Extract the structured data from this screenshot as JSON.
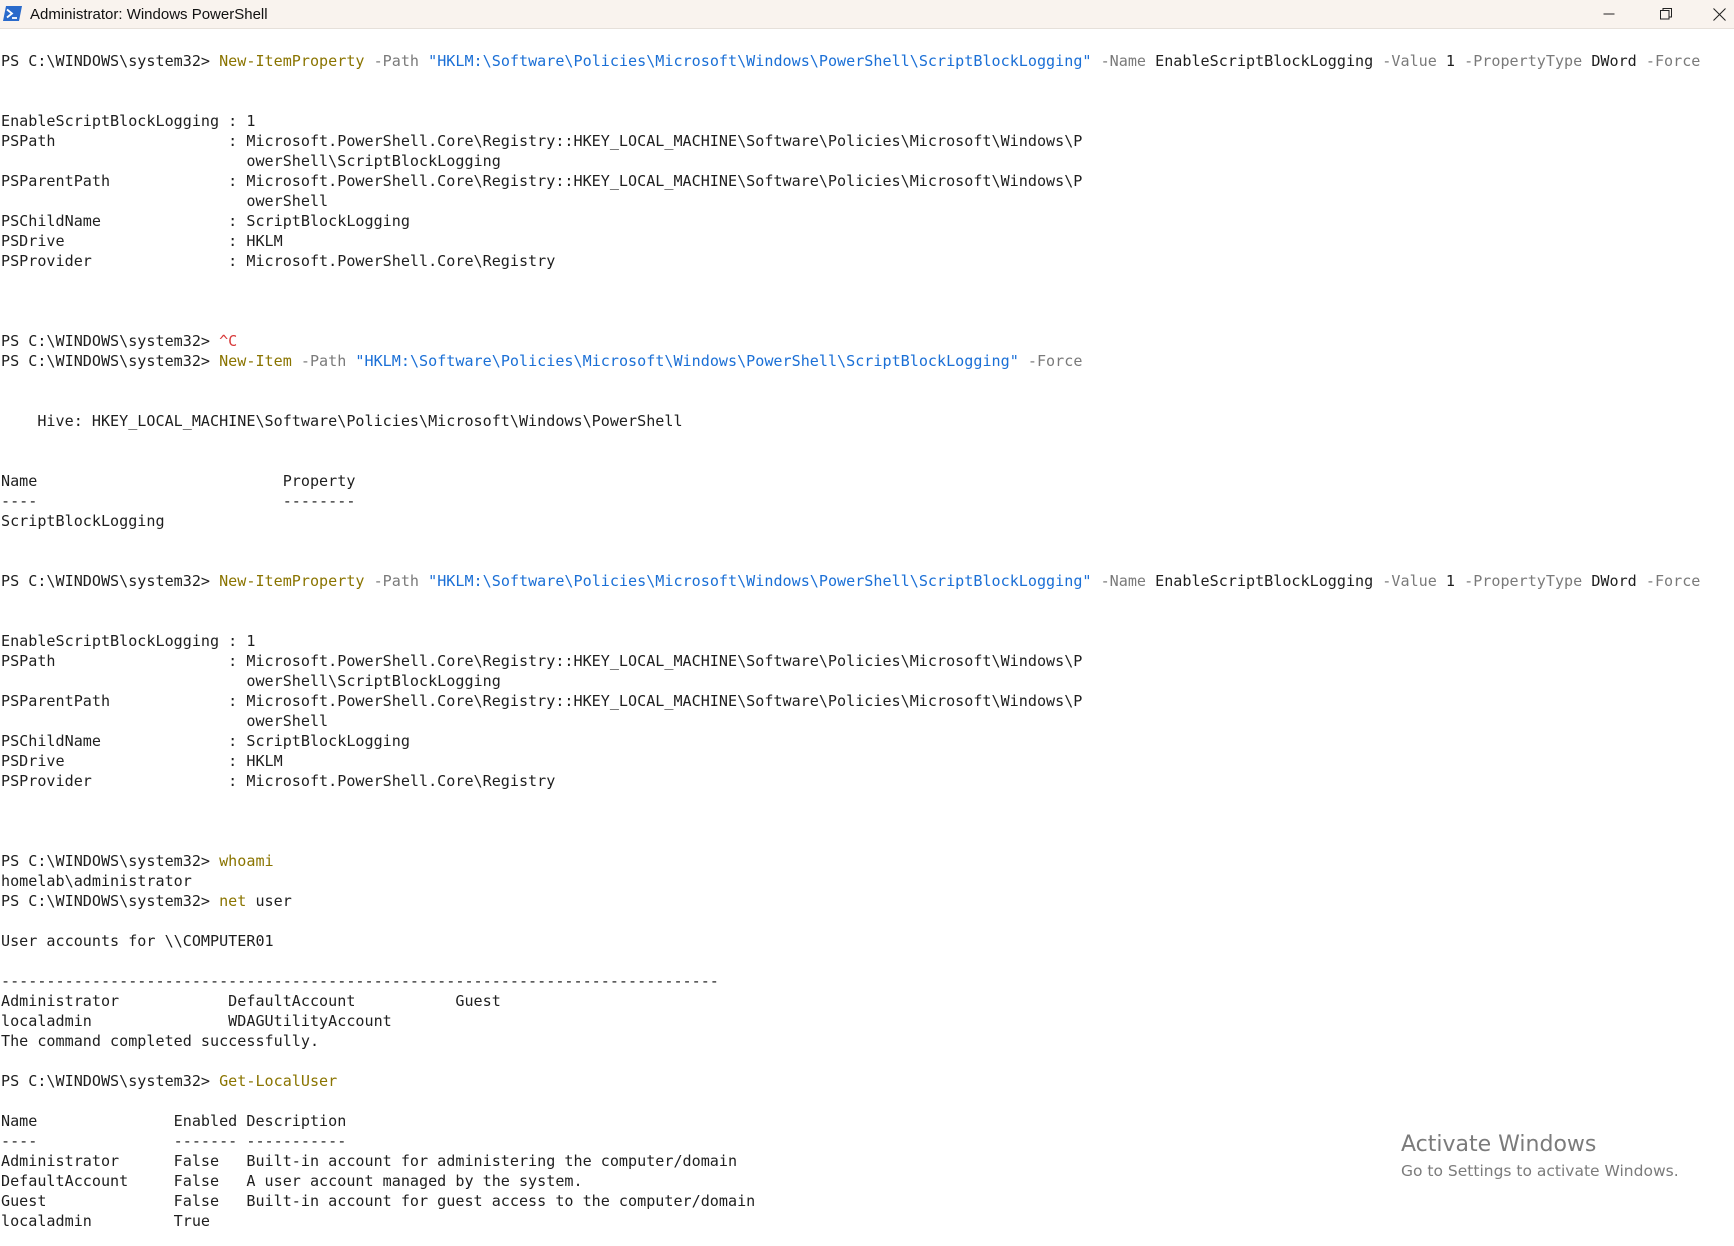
{
  "window": {
    "title": "Administrator: Windows PowerShell",
    "icon": "powershell-icon",
    "controls": {
      "minimize": "minimize-icon",
      "restore": "restore-icon",
      "close": "close-icon"
    }
  },
  "colors": {
    "background": "#ffffff",
    "text": "#1e1e1e",
    "cmdlet": "#8a7400",
    "parameter": "#7a7a7a",
    "string": "#1a6fd6",
    "ctrl_c": "#d83a3a"
  },
  "console": {
    "lines": [
      {
        "segs": [
          {
            "t": "PS C:\\WINDOWS\\system32> "
          },
          {
            "t": "New-ItemProperty",
            "c": "cmd"
          },
          {
            "t": " -Path ",
            "c": "param"
          },
          {
            "t": "\"HKLM:\\Software\\Policies\\Microsoft\\Windows\\PowerShell\\ScriptBlockLogging\"",
            "c": "str"
          },
          {
            "t": " -Name ",
            "c": "param"
          },
          {
            "t": "EnableScriptBlockLogging"
          },
          {
            "t": " -Value ",
            "c": "param"
          },
          {
            "t": "1"
          },
          {
            "t": " -PropertyType ",
            "c": "param"
          },
          {
            "t": "DWord"
          },
          {
            "t": " -Force",
            "c": "param"
          }
        ]
      },
      {
        "text": ""
      },
      {
        "text": ""
      },
      {
        "text": "EnableScriptBlockLogging : 1"
      },
      {
        "text": "PSPath                   : Microsoft.PowerShell.Core\\Registry::HKEY_LOCAL_MACHINE\\Software\\Policies\\Microsoft\\Windows\\P"
      },
      {
        "text": "                           owerShell\\ScriptBlockLogging"
      },
      {
        "text": "PSParentPath             : Microsoft.PowerShell.Core\\Registry::HKEY_LOCAL_MACHINE\\Software\\Policies\\Microsoft\\Windows\\P"
      },
      {
        "text": "                           owerShell"
      },
      {
        "text": "PSChildName              : ScriptBlockLogging"
      },
      {
        "text": "PSDrive                  : HKLM"
      },
      {
        "text": "PSProvider               : Microsoft.PowerShell.Core\\Registry"
      },
      {
        "text": ""
      },
      {
        "text": ""
      },
      {
        "text": ""
      },
      {
        "segs": [
          {
            "t": "PS C:\\WINDOWS\\system32> "
          },
          {
            "t": "^C",
            "c": "ctrl"
          }
        ]
      },
      {
        "segs": [
          {
            "t": "PS C:\\WINDOWS\\system32> "
          },
          {
            "t": "New-Item",
            "c": "cmd"
          },
          {
            "t": " -Path ",
            "c": "param"
          },
          {
            "t": "\"HKLM:\\Software\\Policies\\Microsoft\\Windows\\PowerShell\\ScriptBlockLogging\"",
            "c": "str"
          },
          {
            "t": " -Force",
            "c": "param"
          }
        ]
      },
      {
        "text": ""
      },
      {
        "text": ""
      },
      {
        "text": "    Hive: HKEY_LOCAL_MACHINE\\Software\\Policies\\Microsoft\\Windows\\PowerShell"
      },
      {
        "text": ""
      },
      {
        "text": ""
      },
      {
        "text": "Name                           Property"
      },
      {
        "text": "----                           --------"
      },
      {
        "text": "ScriptBlockLogging"
      },
      {
        "text": ""
      },
      {
        "text": ""
      },
      {
        "segs": [
          {
            "t": "PS C:\\WINDOWS\\system32> "
          },
          {
            "t": "New-ItemProperty",
            "c": "cmd"
          },
          {
            "t": " -Path ",
            "c": "param"
          },
          {
            "t": "\"HKLM:\\Software\\Policies\\Microsoft\\Windows\\PowerShell\\ScriptBlockLogging\"",
            "c": "str"
          },
          {
            "t": " -Name ",
            "c": "param"
          },
          {
            "t": "EnableScriptBlockLogging"
          },
          {
            "t": " -Value ",
            "c": "param"
          },
          {
            "t": "1"
          },
          {
            "t": " -PropertyType ",
            "c": "param"
          },
          {
            "t": "DWord"
          },
          {
            "t": " -Force",
            "c": "param"
          }
        ]
      },
      {
        "text": ""
      },
      {
        "text": ""
      },
      {
        "text": "EnableScriptBlockLogging : 1"
      },
      {
        "text": "PSPath                   : Microsoft.PowerShell.Core\\Registry::HKEY_LOCAL_MACHINE\\Software\\Policies\\Microsoft\\Windows\\P"
      },
      {
        "text": "                           owerShell\\ScriptBlockLogging"
      },
      {
        "text": "PSParentPath             : Microsoft.PowerShell.Core\\Registry::HKEY_LOCAL_MACHINE\\Software\\Policies\\Microsoft\\Windows\\P"
      },
      {
        "text": "                           owerShell"
      },
      {
        "text": "PSChildName              : ScriptBlockLogging"
      },
      {
        "text": "PSDrive                  : HKLM"
      },
      {
        "text": "PSProvider               : Microsoft.PowerShell.Core\\Registry"
      },
      {
        "text": ""
      },
      {
        "text": ""
      },
      {
        "text": ""
      },
      {
        "segs": [
          {
            "t": "PS C:\\WINDOWS\\system32> "
          },
          {
            "t": "whoami",
            "c": "cmd"
          }
        ]
      },
      {
        "text": "homelab\\administrator"
      },
      {
        "segs": [
          {
            "t": "PS C:\\WINDOWS\\system32> "
          },
          {
            "t": "net",
            "c": "cmd"
          },
          {
            "t": " user"
          }
        ]
      },
      {
        "text": ""
      },
      {
        "text": "User accounts for \\\\COMPUTER01"
      },
      {
        "text": ""
      },
      {
        "text": "-------------------------------------------------------------------------------"
      },
      {
        "text": "Administrator            DefaultAccount           Guest"
      },
      {
        "text": "localadmin               WDAGUtilityAccount"
      },
      {
        "text": "The command completed successfully."
      },
      {
        "text": ""
      },
      {
        "segs": [
          {
            "t": "PS C:\\WINDOWS\\system32> "
          },
          {
            "t": "Get-LocalUser",
            "c": "cmd"
          }
        ]
      },
      {
        "text": ""
      },
      {
        "text": "Name               Enabled Description"
      },
      {
        "text": "----               ------- -----------"
      },
      {
        "text": "Administrator      False   Built-in account for administering the computer/domain"
      },
      {
        "text": "DefaultAccount     False   A user account managed by the system."
      },
      {
        "text": "Guest              False   Built-in account for guest access to the computer/domain"
      },
      {
        "text": "localadmin         True"
      }
    ]
  },
  "watermark": {
    "title": "Activate Windows",
    "subtitle": "Go to Settings to activate Windows."
  }
}
